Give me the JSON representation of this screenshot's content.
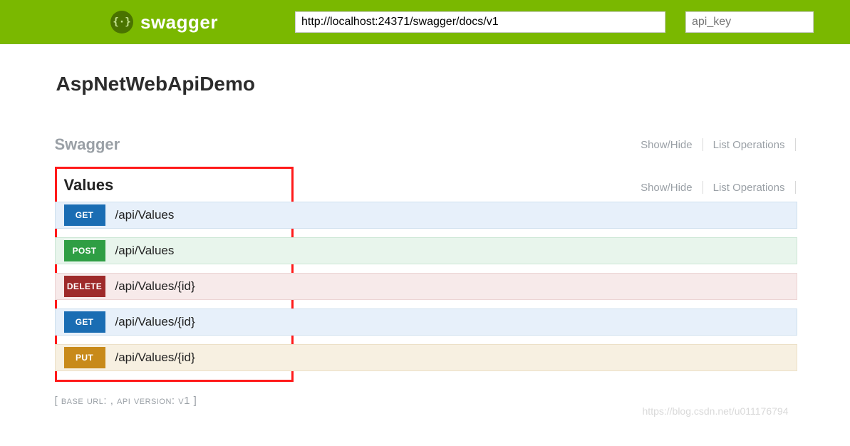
{
  "header": {
    "brand": "swagger",
    "url_value": "http://localhost:24371/swagger/docs/v1",
    "api_key_placeholder": "api_key"
  },
  "api": {
    "title": "AspNetWebApiDemo"
  },
  "sections": [
    {
      "name": "Swagger",
      "active": false,
      "actions": {
        "show_hide": "Show/Hide",
        "list_ops": "List Operations"
      }
    },
    {
      "name": "Values",
      "active": true,
      "actions": {
        "show_hide": "Show/Hide",
        "list_ops": "List Operations"
      },
      "operations": [
        {
          "method": "GET",
          "path": "/api/Values"
        },
        {
          "method": "POST",
          "path": "/api/Values"
        },
        {
          "method": "DELETE",
          "path": "/api/Values/{id}"
        },
        {
          "method": "GET",
          "path": "/api/Values/{id}"
        },
        {
          "method": "PUT",
          "path": "/api/Values/{id}"
        }
      ]
    }
  ],
  "footer": {
    "meta": "[ base url: , api version: v1 ]"
  },
  "watermark": "https://blog.csdn.net/u011176794"
}
